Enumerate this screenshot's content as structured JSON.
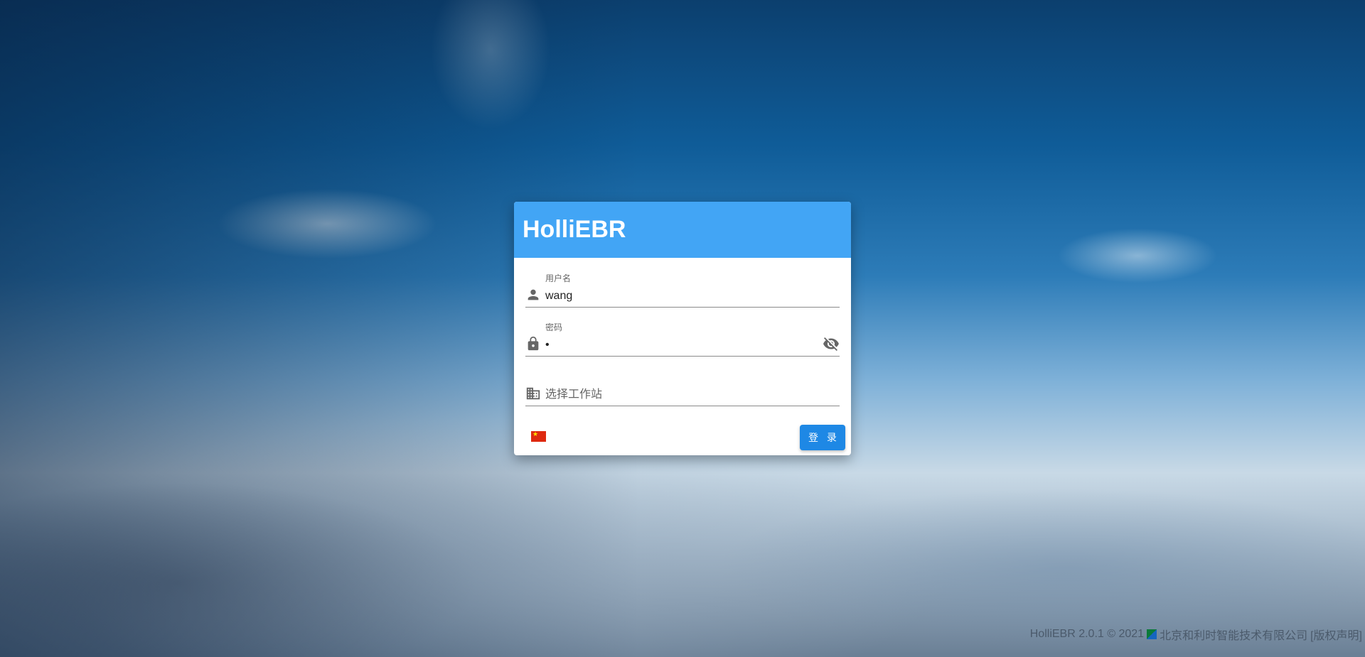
{
  "app": {
    "title": "HolliEBR"
  },
  "form": {
    "username": {
      "label": "用户名",
      "value": "wang",
      "icon": "person-icon"
    },
    "password": {
      "label": "密码",
      "value": "•",
      "icon": "lock-icon",
      "toggle_icon": "eye-off-icon"
    },
    "workstation": {
      "placeholder": "选择工作站",
      "icon": "building-icon"
    },
    "language": {
      "icon": "china-flag-icon"
    },
    "login_button": "登 录"
  },
  "footer": {
    "version_text": "HolliEBR 2.0.1 © 2021",
    "company": "北京和利时智能技术有限公司",
    "license_link": "[版权声明]"
  },
  "colors": {
    "header": "#42a5f5",
    "button": "#1e88e5"
  }
}
